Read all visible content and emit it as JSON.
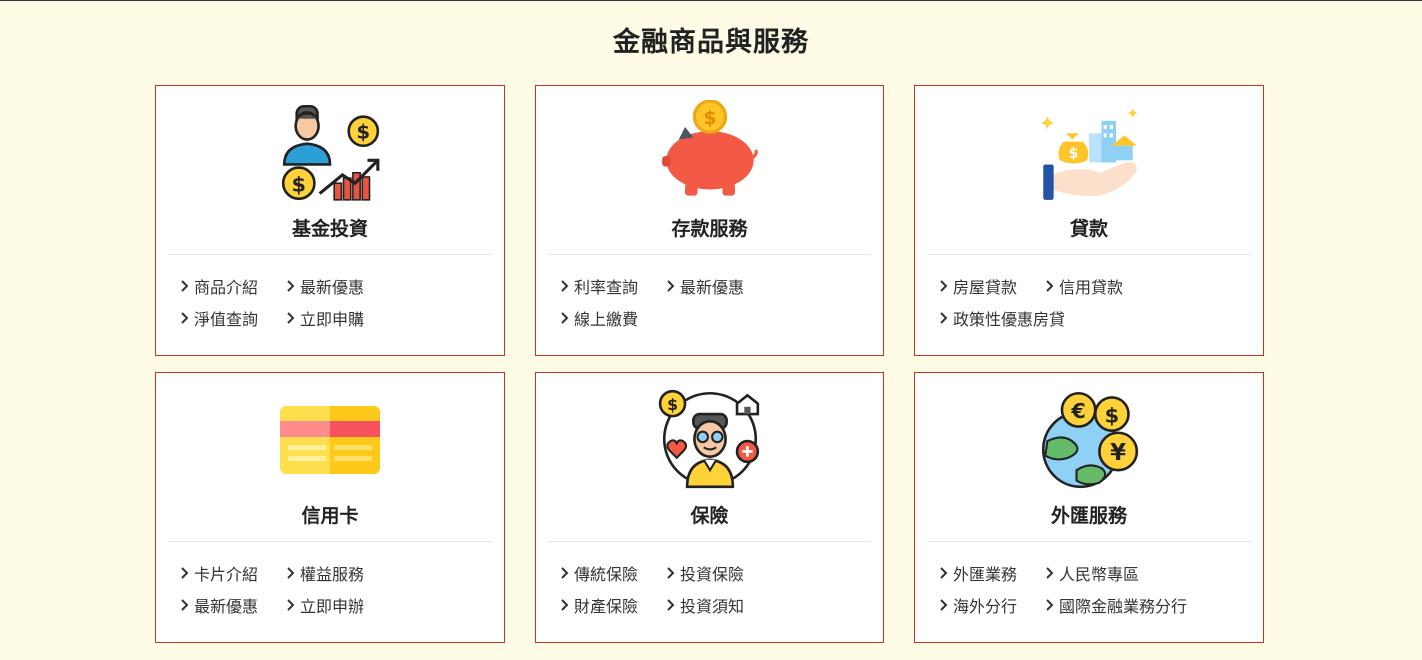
{
  "page": {
    "title": "金融商品與服務"
  },
  "cards": [
    {
      "title": "基金投資",
      "icon": "investor-growth-icon",
      "links": [
        "商品介紹",
        "最新優惠",
        "淨值查詢",
        "立即申購"
      ]
    },
    {
      "title": "存款服務",
      "icon": "piggy-bank-icon",
      "links": [
        "利率查詢",
        "最新優惠",
        "線上繳費"
      ]
    },
    {
      "title": "貸款",
      "icon": "loan-hand-icon",
      "links": [
        "房屋貸款",
        "信用貸款",
        "政策性優惠房貸"
      ]
    },
    {
      "title": "信用卡",
      "icon": "credit-card-icon",
      "links": [
        "卡片介紹",
        "權益服務",
        "最新優惠",
        "立即申辦"
      ]
    },
    {
      "title": "保險",
      "icon": "insurance-person-icon",
      "links": [
        "傳統保險",
        "投資保險",
        "財產保險",
        "投資須知"
      ]
    },
    {
      "title": "外匯服務",
      "icon": "foreign-exchange-icon",
      "links": [
        "外匯業務",
        "人民幣專區",
        "海外分行",
        "國際金融業務分行"
      ]
    }
  ],
  "colors": {
    "background": "#fefce4",
    "card_border": "#c9341f"
  }
}
